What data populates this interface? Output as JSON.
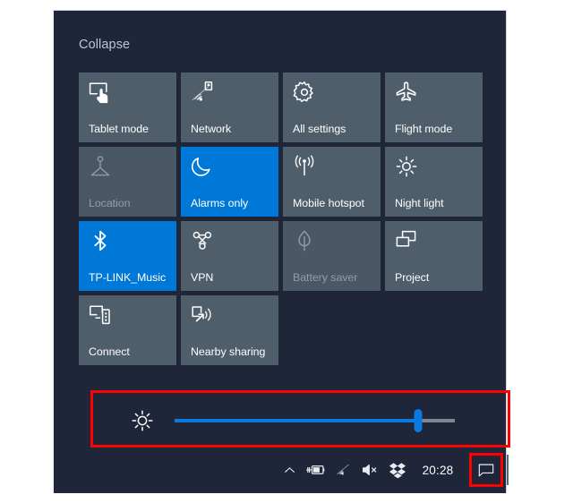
{
  "panel": {
    "collapse_label": "Collapse",
    "background_color": "#1f2639",
    "accent_color": "#0078d7",
    "tile_color": "#4f5e6b",
    "annotation_color": "#ff0000"
  },
  "tiles": [
    {
      "label": "Tablet mode",
      "icon": "tablet-mode-icon",
      "state": "normal"
    },
    {
      "label": "Network",
      "icon": "network-icon",
      "state": "normal"
    },
    {
      "label": "All settings",
      "icon": "gear-icon",
      "state": "normal"
    },
    {
      "label": "Flight mode",
      "icon": "airplane-icon",
      "state": "normal"
    },
    {
      "label": "Location",
      "icon": "location-icon",
      "state": "disabled"
    },
    {
      "label": "Alarms only",
      "icon": "moon-icon",
      "state": "on"
    },
    {
      "label": "Mobile hotspot",
      "icon": "hotspot-icon",
      "state": "normal"
    },
    {
      "label": "Night light",
      "icon": "sun-icon",
      "state": "normal"
    },
    {
      "label": "TP-LINK_Music",
      "icon": "bluetooth-icon",
      "state": "on"
    },
    {
      "label": "VPN",
      "icon": "vpn-icon",
      "state": "normal"
    },
    {
      "label": "Battery saver",
      "icon": "leaf-icon",
      "state": "disabled"
    },
    {
      "label": "Project",
      "icon": "project-icon",
      "state": "normal"
    },
    {
      "label": "Connect",
      "icon": "connect-icon",
      "state": "normal"
    },
    {
      "label": "Nearby sharing",
      "icon": "nearby-sharing-icon",
      "state": "normal"
    }
  ],
  "brightness": {
    "icon": "brightness-icon",
    "value_percent": 87
  },
  "taskbar": {
    "chevron_icon": "chevron-up-icon",
    "battery_icon": "battery-charging-icon",
    "wifi_icon": "wifi-icon",
    "volume_icon": "speaker-muted-icon",
    "dropbox_icon": "dropbox-icon",
    "clock": "20:28",
    "action_center_icon": "action-center-icon"
  }
}
